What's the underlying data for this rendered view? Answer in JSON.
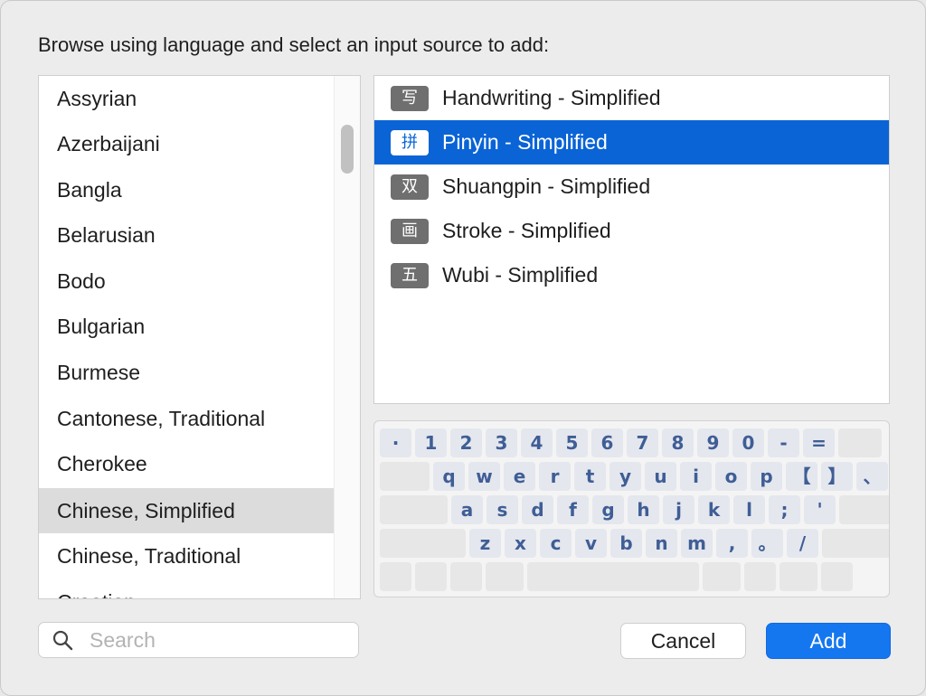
{
  "prompt": "Browse using language and select an input source to add:",
  "languages": [
    {
      "label": "Assyrian"
    },
    {
      "label": "Azerbaijani"
    },
    {
      "label": "Bangla"
    },
    {
      "label": "Belarusian"
    },
    {
      "label": "Bodo"
    },
    {
      "label": "Bulgarian"
    },
    {
      "label": "Burmese"
    },
    {
      "label": "Cantonese, Traditional"
    },
    {
      "label": "Cherokee"
    },
    {
      "label": "Chinese, Simplified"
    },
    {
      "label": "Chinese, Traditional"
    },
    {
      "label": "Croatian"
    }
  ],
  "selected_language": "Chinese, Simplified",
  "input_sources": [
    {
      "icon": "写",
      "label": "Handwriting - Simplified"
    },
    {
      "icon": "拼",
      "label": "Pinyin - Simplified"
    },
    {
      "icon": "双",
      "label": "Shuangpin - Simplified"
    },
    {
      "icon": "画",
      "label": "Stroke - Simplified"
    },
    {
      "icon": "五",
      "label": "Wubi - Simplified"
    }
  ],
  "selected_source": "Pinyin - Simplified",
  "keyboard": {
    "row1": [
      "·",
      "1",
      "2",
      "3",
      "4",
      "5",
      "6",
      "7",
      "8",
      "9",
      "0",
      "-",
      "=",
      ""
    ],
    "row2": [
      "",
      "q",
      "w",
      "e",
      "r",
      "t",
      "y",
      "u",
      "i",
      "o",
      "p",
      "【",
      "】",
      "、"
    ],
    "row3": [
      "",
      "a",
      "s",
      "d",
      "f",
      "g",
      "h",
      "j",
      "k",
      "l",
      ";",
      "'",
      ""
    ],
    "row4": [
      "",
      "z",
      "x",
      "c",
      "v",
      "b",
      "n",
      "m",
      ",",
      "。",
      "/",
      ""
    ]
  },
  "search": {
    "placeholder": "Search",
    "value": ""
  },
  "buttons": {
    "cancel": "Cancel",
    "add": "Add"
  },
  "colors": {
    "selection": "#0a64d6",
    "add_button": "#1577f0",
    "key_text": "#3f5e96"
  }
}
